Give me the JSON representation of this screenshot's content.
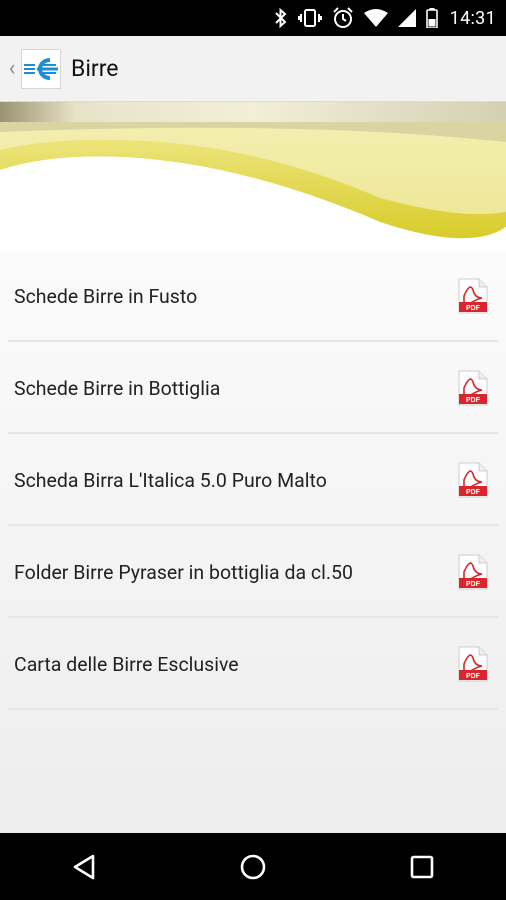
{
  "status_bar": {
    "time": "14:31",
    "icons": [
      "bluetooth-icon",
      "vibrate-icon",
      "alarm-icon",
      "wifi-icon",
      "signal-icon",
      "battery-icon"
    ]
  },
  "action_bar": {
    "back_glyph": "‹",
    "title": "Birre"
  },
  "list": {
    "items": [
      {
        "label": "Schede Birre in Fusto",
        "icon": "pdf-icon"
      },
      {
        "label": "Schede Birre in Bottiglia",
        "icon": "pdf-icon"
      },
      {
        "label": "Scheda Birra L'Italica 5.0 Puro Malto",
        "icon": "pdf-icon"
      },
      {
        "label": "Folder Birre Pyraser in bottiglia da cl.50",
        "icon": "pdf-icon"
      },
      {
        "label": "Carta delle Birre Esclusive",
        "icon": "pdf-icon"
      }
    ]
  },
  "nav_bar": {
    "buttons": [
      "back-icon",
      "home-icon",
      "recents-icon"
    ]
  },
  "colors": {
    "status_bar": "#000000",
    "action_bar": "#f2f2f2",
    "beer_yellow": "#e8dc3a",
    "pdf_red": "#d9262c"
  }
}
